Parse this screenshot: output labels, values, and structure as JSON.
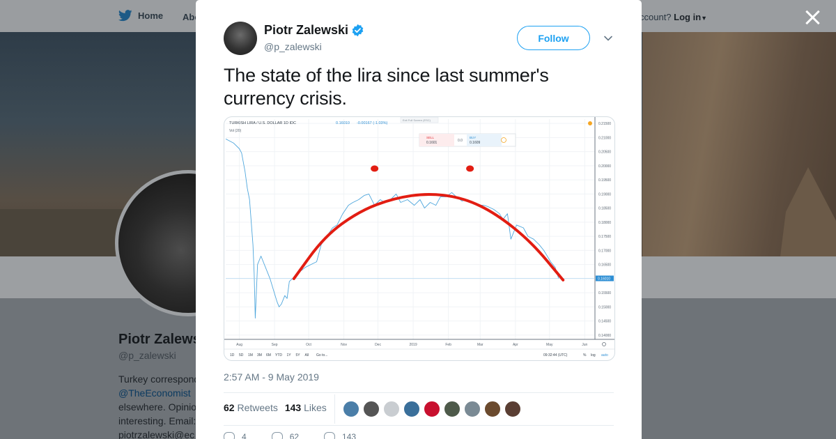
{
  "background": {
    "nav": {
      "home_label": "Home",
      "about_label": "Abo",
      "login_prompt": "ccount?",
      "login_label": "Log in"
    },
    "profile": {
      "name": "Piotr Zalewski",
      "handle": "@p_zalewski",
      "bio_line1": "Turkey correspond",
      "bio_link": "@TheEconomist",
      "bio_line2": "elsewhere. Opinio",
      "bio_line3": "interesting. Email:",
      "bio_line4": "piotrzalewski@ec"
    }
  },
  "tweet": {
    "author_name": "Piotr Zalewski",
    "author_handle": "@p_zalewski",
    "follow_label": "Follow",
    "text": "The state of the lira since last summer's currency crisis.",
    "timestamp": "2:57 AM - 9 May 2019",
    "retweets_count": "62",
    "retweets_label": "Retweets",
    "likes_count": "143",
    "likes_label": "Likes",
    "reply_count": "4",
    "retweet_action_count": "62",
    "like_action_count": "143",
    "liker_colors": [
      "#4a7ea8",
      "#555555",
      "#c9cdd1",
      "#3a6f9a",
      "#c8102e",
      "#4e5a4a",
      "#7a8a94",
      "#6b4a2e",
      "#5a3e33"
    ]
  },
  "chart_data": {
    "type": "line",
    "title": "TURKISH LIRA / U.S. DOLLAR  1D  IDC",
    "header_value": "0.16010",
    "header_change": "-0.00167 (-1.03%)",
    "volume_label": "Vol (20)",
    "exit_label": "Exit Full Screen (ESC)",
    "sell_label": "SELL",
    "sell_value": "0.1601",
    "spread_value": "0.0",
    "buy_label": "BUY",
    "buy_value": "0.1609",
    "current_price_label": "0.16010",
    "x_tick_labels": [
      "Aug",
      "Sep",
      "Oct",
      "Nov",
      "Dec",
      "2019",
      "Feb",
      "Mar",
      "Apr",
      "May",
      "Jun"
    ],
    "y_tick_labels": [
      "0.21500",
      "0.21000",
      "0.20500",
      "0.20000",
      "0.19500",
      "0.19000",
      "0.18500",
      "0.18000",
      "0.17500",
      "0.17000",
      "0.16500",
      "0.16000",
      "0.15500",
      "0.15000",
      "0.14500",
      "0.14000"
    ],
    "ylim": [
      0.1385,
      0.2165
    ],
    "timeframes": [
      "1D",
      "5D",
      "1M",
      "3M",
      "6M",
      "YTD",
      "1Y",
      "5Y",
      "All",
      "Go to..."
    ],
    "clock": "09:32:44 (UTC)",
    "bottom_right": [
      "%",
      "log",
      "auto"
    ],
    "series": [
      {
        "color": "#4ea6dc",
        "x": [
          "2018-07-20",
          "2018-07-27",
          "2018-08-01",
          "2018-08-03",
          "2018-08-06",
          "2018-08-08",
          "2018-08-10",
          "2018-08-13",
          "2018-08-14",
          "2018-08-15",
          "2018-08-17",
          "2018-08-20",
          "2018-08-24",
          "2018-08-28",
          "2018-08-31",
          "2018-09-03",
          "2018-09-05",
          "2018-09-07",
          "2018-09-10",
          "2018-09-12",
          "2018-09-14",
          "2018-09-18",
          "2018-09-21",
          "2018-09-25",
          "2018-09-28",
          "2018-10-03",
          "2018-10-08",
          "2018-10-12",
          "2018-10-17",
          "2018-10-22",
          "2018-10-26",
          "2018-10-31",
          "2018-11-05",
          "2018-11-09",
          "2018-11-14",
          "2018-11-19",
          "2018-11-23",
          "2018-11-28",
          "2018-12-03",
          "2018-12-07",
          "2018-12-12",
          "2018-12-17",
          "2018-12-21",
          "2018-12-27",
          "2019-01-02",
          "2019-01-07",
          "2019-01-11",
          "2019-01-16",
          "2019-01-21",
          "2019-01-25",
          "2019-01-30",
          "2019-02-04",
          "2019-02-08",
          "2019-02-13",
          "2019-02-18",
          "2019-02-22",
          "2019-02-27",
          "2019-03-04",
          "2019-03-08",
          "2019-03-13",
          "2019-03-18",
          "2019-03-21",
          "2019-03-25",
          "2019-03-28",
          "2019-04-02",
          "2019-04-08",
          "2019-04-12",
          "2019-04-17",
          "2019-04-22",
          "2019-04-26",
          "2019-05-02",
          "2019-05-06",
          "2019-05-09"
        ],
        "y": [
          0.2095,
          0.208,
          0.206,
          0.2045,
          0.198,
          0.192,
          0.188,
          0.172,
          0.162,
          0.146,
          0.165,
          0.168,
          0.164,
          0.16,
          0.156,
          0.152,
          0.15,
          0.151,
          0.154,
          0.153,
          0.159,
          0.1605,
          0.162,
          0.163,
          0.164,
          0.165,
          0.166,
          0.172,
          0.175,
          0.178,
          0.179,
          0.183,
          0.186,
          0.187,
          0.188,
          0.1895,
          0.19,
          0.186,
          0.188,
          0.187,
          0.188,
          0.19,
          0.187,
          0.188,
          0.186,
          0.188,
          0.185,
          0.187,
          0.186,
          0.189,
          0.189,
          0.1905,
          0.189,
          0.1875,
          0.188,
          0.187,
          0.186,
          0.186,
          0.1855,
          0.1845,
          0.183,
          0.181,
          0.183,
          0.174,
          0.179,
          0.178,
          0.175,
          0.174,
          0.172,
          0.17,
          0.166,
          0.164,
          0.1601
        ]
      }
    ],
    "annotation_color": "#e21d12",
    "annotation_arc": {
      "x": [
        "2018-09-18",
        "2018-10-15",
        "2018-11-15",
        "2018-12-15",
        "2019-01-15",
        "2019-02-15",
        "2019-03-15",
        "2019-04-15",
        "2019-05-13"
      ],
      "y": [
        0.16,
        0.175,
        0.184,
        0.1885,
        0.1903,
        0.1885,
        0.183,
        0.173,
        0.1595
      ]
    },
    "annotation_dots": [
      {
        "x": "2018-11-28",
        "y": 0.199
      },
      {
        "x": "2019-02-20",
        "y": 0.199
      }
    ]
  }
}
